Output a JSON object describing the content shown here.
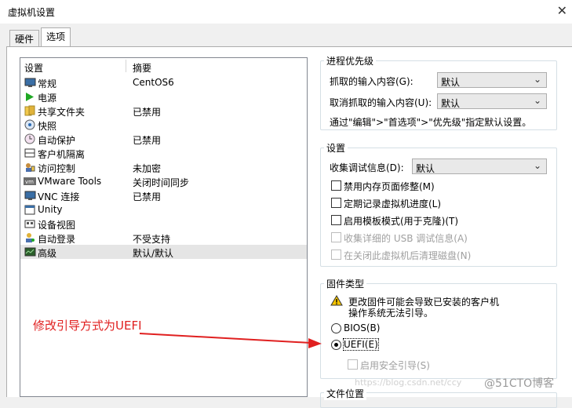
{
  "window": {
    "title": "虚拟机设置"
  },
  "tabs": [
    {
      "label": "硬件"
    },
    {
      "label": "选项"
    }
  ],
  "list": {
    "headers": {
      "setting": "设置",
      "summary": "摘要"
    },
    "items": [
      {
        "name": "常规",
        "summary": "CentOS6",
        "icon": "monitor-icon"
      },
      {
        "name": "电源",
        "summary": "",
        "icon": "power-play-icon"
      },
      {
        "name": "共享文件夹",
        "summary": "已禁用",
        "icon": "shared-folder-icon"
      },
      {
        "name": "快照",
        "summary": "",
        "icon": "snapshot-icon"
      },
      {
        "name": "自动保护",
        "summary": "已禁用",
        "icon": "autoprotect-icon"
      },
      {
        "name": "客户机隔离",
        "summary": "",
        "icon": "isolation-icon"
      },
      {
        "name": "访问控制",
        "summary": "未加密",
        "icon": "access-control-icon"
      },
      {
        "name": "VMware Tools",
        "summary": "关闭时间同步",
        "icon": "vmware-tools-icon"
      },
      {
        "name": "VNC 连接",
        "summary": "已禁用",
        "icon": "vnc-icon"
      },
      {
        "name": "Unity",
        "summary": "",
        "icon": "unity-icon"
      },
      {
        "name": "设备视图",
        "summary": "",
        "icon": "device-view-icon"
      },
      {
        "name": "自动登录",
        "summary": "不受支持",
        "icon": "autologin-icon"
      },
      {
        "name": "高级",
        "summary": "默认/默认",
        "icon": "advanced-icon"
      }
    ]
  },
  "process_priority": {
    "title": "进程优先级",
    "grab_label": "抓取的输入内容(G):",
    "grab_value": "默认",
    "ungrab_label": "取消抓取的输入内容(U):",
    "ungrab_value": "默认",
    "note": "通过\"编辑\">\"首选项\">\"优先级\"指定默认设置。"
  },
  "settings": {
    "title": "设置",
    "debug_label": "收集调试信息(D):",
    "debug_value": "默认",
    "checkboxes": [
      {
        "label": "禁用内存页面修整(M)"
      },
      {
        "label": "定期记录虚拟机进度(L)"
      },
      {
        "label": "启用模板模式(用于克隆)(T)"
      },
      {
        "label": "收集详细的 USB 调试信息(A)"
      },
      {
        "label": "在关闭此虚拟机后清理磁盘(N)"
      }
    ]
  },
  "firmware": {
    "title": "固件类型",
    "warning_line1": "更改固件可能会导致已安装的客户机",
    "warning_line2": "操作系统无法引导。",
    "bios_label": "BIOS(B)",
    "uefi_label": "UEFI(E)",
    "secure_boot_label": "启用安全引导(S)",
    "selected": "UEFI"
  },
  "file_location": {
    "title": "文件位置"
  },
  "annotation": {
    "text": "修改引导方式为UEFI"
  },
  "watermark": {
    "url": "https://blog.csdn.net/ccy",
    "brand": "@51CTO博客"
  },
  "colors": {
    "arrow": "#e02020",
    "warning": "#f5c400",
    "selection": "#e5e5e5"
  }
}
